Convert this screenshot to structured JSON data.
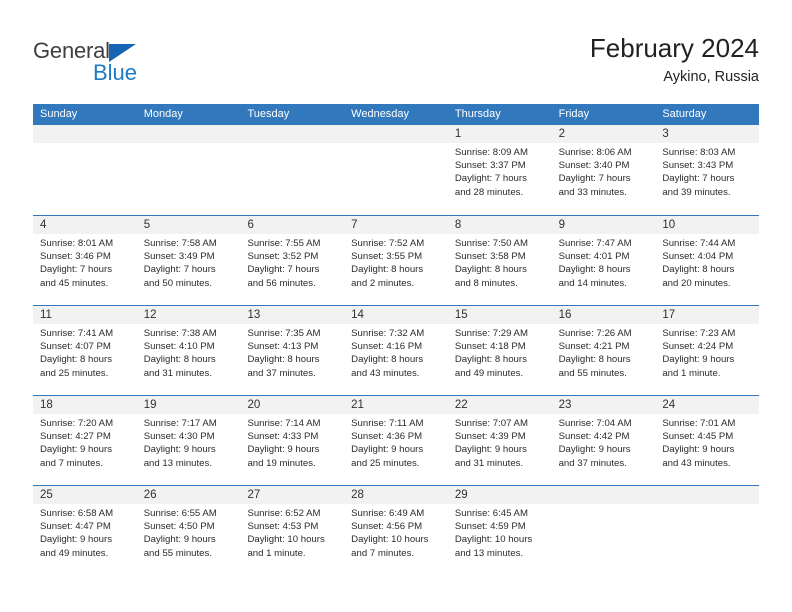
{
  "brand": {
    "name_top": "General",
    "name_bottom": "Blue",
    "triangle_color": "#1665b4",
    "blue_color": "#1f7ac4"
  },
  "header": {
    "title": "February 2024",
    "location": "Aykino, Russia"
  },
  "calendar": {
    "accent_color": "#3178bd",
    "band_color": "#f2f2f2",
    "weekdays": [
      "Sunday",
      "Monday",
      "Tuesday",
      "Wednesday",
      "Thursday",
      "Friday",
      "Saturday"
    ],
    "weeks": [
      [
        {
          "day": "",
          "lines": []
        },
        {
          "day": "",
          "lines": []
        },
        {
          "day": "",
          "lines": []
        },
        {
          "day": "",
          "lines": []
        },
        {
          "day": "1",
          "lines": [
            "Sunrise: 8:09 AM",
            "Sunset: 3:37 PM",
            "Daylight: 7 hours",
            "and 28 minutes."
          ]
        },
        {
          "day": "2",
          "lines": [
            "Sunrise: 8:06 AM",
            "Sunset: 3:40 PM",
            "Daylight: 7 hours",
            "and 33 minutes."
          ]
        },
        {
          "day": "3",
          "lines": [
            "Sunrise: 8:03 AM",
            "Sunset: 3:43 PM",
            "Daylight: 7 hours",
            "and 39 minutes."
          ]
        }
      ],
      [
        {
          "day": "4",
          "lines": [
            "Sunrise: 8:01 AM",
            "Sunset: 3:46 PM",
            "Daylight: 7 hours",
            "and 45 minutes."
          ]
        },
        {
          "day": "5",
          "lines": [
            "Sunrise: 7:58 AM",
            "Sunset: 3:49 PM",
            "Daylight: 7 hours",
            "and 50 minutes."
          ]
        },
        {
          "day": "6",
          "lines": [
            "Sunrise: 7:55 AM",
            "Sunset: 3:52 PM",
            "Daylight: 7 hours",
            "and 56 minutes."
          ]
        },
        {
          "day": "7",
          "lines": [
            "Sunrise: 7:52 AM",
            "Sunset: 3:55 PM",
            "Daylight: 8 hours",
            "and 2 minutes."
          ]
        },
        {
          "day": "8",
          "lines": [
            "Sunrise: 7:50 AM",
            "Sunset: 3:58 PM",
            "Daylight: 8 hours",
            "and 8 minutes."
          ]
        },
        {
          "day": "9",
          "lines": [
            "Sunrise: 7:47 AM",
            "Sunset: 4:01 PM",
            "Daylight: 8 hours",
            "and 14 minutes."
          ]
        },
        {
          "day": "10",
          "lines": [
            "Sunrise: 7:44 AM",
            "Sunset: 4:04 PM",
            "Daylight: 8 hours",
            "and 20 minutes."
          ]
        }
      ],
      [
        {
          "day": "11",
          "lines": [
            "Sunrise: 7:41 AM",
            "Sunset: 4:07 PM",
            "Daylight: 8 hours",
            "and 25 minutes."
          ]
        },
        {
          "day": "12",
          "lines": [
            "Sunrise: 7:38 AM",
            "Sunset: 4:10 PM",
            "Daylight: 8 hours",
            "and 31 minutes."
          ]
        },
        {
          "day": "13",
          "lines": [
            "Sunrise: 7:35 AM",
            "Sunset: 4:13 PM",
            "Daylight: 8 hours",
            "and 37 minutes."
          ]
        },
        {
          "day": "14",
          "lines": [
            "Sunrise: 7:32 AM",
            "Sunset: 4:16 PM",
            "Daylight: 8 hours",
            "and 43 minutes."
          ]
        },
        {
          "day": "15",
          "lines": [
            "Sunrise: 7:29 AM",
            "Sunset: 4:18 PM",
            "Daylight: 8 hours",
            "and 49 minutes."
          ]
        },
        {
          "day": "16",
          "lines": [
            "Sunrise: 7:26 AM",
            "Sunset: 4:21 PM",
            "Daylight: 8 hours",
            "and 55 minutes."
          ]
        },
        {
          "day": "17",
          "lines": [
            "Sunrise: 7:23 AM",
            "Sunset: 4:24 PM",
            "Daylight: 9 hours",
            "and 1 minute."
          ]
        }
      ],
      [
        {
          "day": "18",
          "lines": [
            "Sunrise: 7:20 AM",
            "Sunset: 4:27 PM",
            "Daylight: 9 hours",
            "and 7 minutes."
          ]
        },
        {
          "day": "19",
          "lines": [
            "Sunrise: 7:17 AM",
            "Sunset: 4:30 PM",
            "Daylight: 9 hours",
            "and 13 minutes."
          ]
        },
        {
          "day": "20",
          "lines": [
            "Sunrise: 7:14 AM",
            "Sunset: 4:33 PM",
            "Daylight: 9 hours",
            "and 19 minutes."
          ]
        },
        {
          "day": "21",
          "lines": [
            "Sunrise: 7:11 AM",
            "Sunset: 4:36 PM",
            "Daylight: 9 hours",
            "and 25 minutes."
          ]
        },
        {
          "day": "22",
          "lines": [
            "Sunrise: 7:07 AM",
            "Sunset: 4:39 PM",
            "Daylight: 9 hours",
            "and 31 minutes."
          ]
        },
        {
          "day": "23",
          "lines": [
            "Sunrise: 7:04 AM",
            "Sunset: 4:42 PM",
            "Daylight: 9 hours",
            "and 37 minutes."
          ]
        },
        {
          "day": "24",
          "lines": [
            "Sunrise: 7:01 AM",
            "Sunset: 4:45 PM",
            "Daylight: 9 hours",
            "and 43 minutes."
          ]
        }
      ],
      [
        {
          "day": "25",
          "lines": [
            "Sunrise: 6:58 AM",
            "Sunset: 4:47 PM",
            "Daylight: 9 hours",
            "and 49 minutes."
          ]
        },
        {
          "day": "26",
          "lines": [
            "Sunrise: 6:55 AM",
            "Sunset: 4:50 PM",
            "Daylight: 9 hours",
            "and 55 minutes."
          ]
        },
        {
          "day": "27",
          "lines": [
            "Sunrise: 6:52 AM",
            "Sunset: 4:53 PM",
            "Daylight: 10 hours",
            "and 1 minute."
          ]
        },
        {
          "day": "28",
          "lines": [
            "Sunrise: 6:49 AM",
            "Sunset: 4:56 PM",
            "Daylight: 10 hours",
            "and 7 minutes."
          ]
        },
        {
          "day": "29",
          "lines": [
            "Sunrise: 6:45 AM",
            "Sunset: 4:59 PM",
            "Daylight: 10 hours",
            "and 13 minutes."
          ]
        },
        {
          "day": "",
          "lines": []
        },
        {
          "day": "",
          "lines": []
        }
      ]
    ]
  }
}
